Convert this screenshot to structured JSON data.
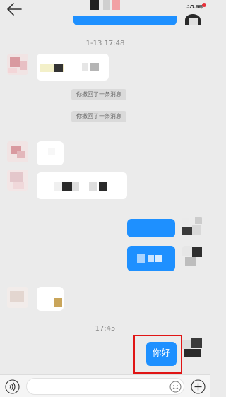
{
  "header": {
    "back_icon": "arrow-left-icon",
    "settings_label": "设置"
  },
  "timestamps": {
    "first": "1-13 17:48",
    "second": "17:45"
  },
  "notices": {
    "recall_1": "你撤回了一条消息",
    "recall_2": "你撤回了一条消息"
  },
  "messages": {
    "last_sent": "你好"
  },
  "input_bar": {
    "voice_icon": "voice-icon",
    "input_value": "",
    "emoji_icon": "smiley-icon",
    "plus_icon": "plus-icon"
  },
  "colors": {
    "accent": "#1e90ff",
    "highlight": "#e01515",
    "background": "#ebebeb",
    "badge": "#e8323c"
  }
}
